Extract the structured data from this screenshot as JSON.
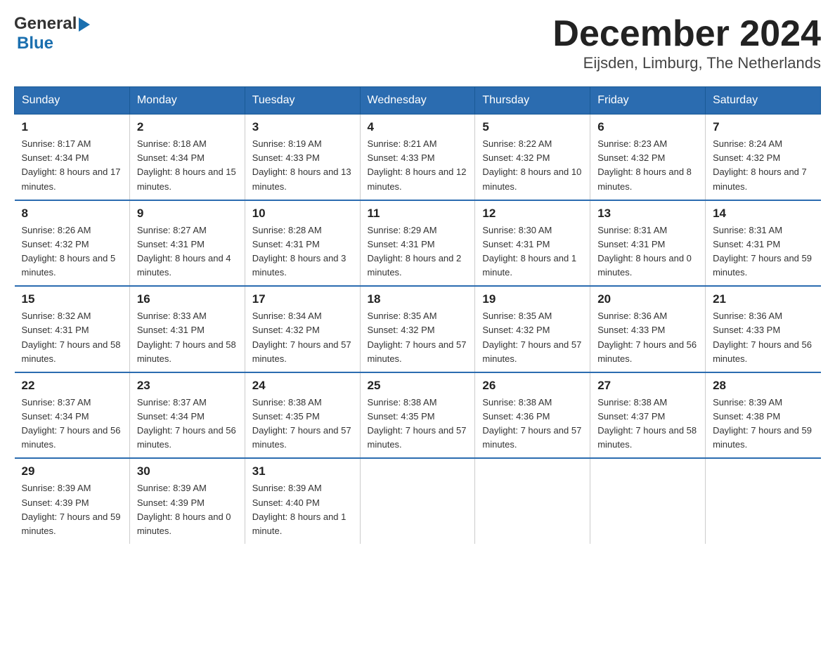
{
  "header": {
    "logo_general": "General",
    "logo_blue": "Blue",
    "month_title": "December 2024",
    "location": "Eijsden, Limburg, The Netherlands"
  },
  "days_of_week": [
    "Sunday",
    "Monday",
    "Tuesday",
    "Wednesday",
    "Thursday",
    "Friday",
    "Saturday"
  ],
  "weeks": [
    [
      {
        "day": "1",
        "sunrise": "8:17 AM",
        "sunset": "4:34 PM",
        "daylight": "8 hours and 17 minutes."
      },
      {
        "day": "2",
        "sunrise": "8:18 AM",
        "sunset": "4:34 PM",
        "daylight": "8 hours and 15 minutes."
      },
      {
        "day": "3",
        "sunrise": "8:19 AM",
        "sunset": "4:33 PM",
        "daylight": "8 hours and 13 minutes."
      },
      {
        "day": "4",
        "sunrise": "8:21 AM",
        "sunset": "4:33 PM",
        "daylight": "8 hours and 12 minutes."
      },
      {
        "day": "5",
        "sunrise": "8:22 AM",
        "sunset": "4:32 PM",
        "daylight": "8 hours and 10 minutes."
      },
      {
        "day": "6",
        "sunrise": "8:23 AM",
        "sunset": "4:32 PM",
        "daylight": "8 hours and 8 minutes."
      },
      {
        "day": "7",
        "sunrise": "8:24 AM",
        "sunset": "4:32 PM",
        "daylight": "8 hours and 7 minutes."
      }
    ],
    [
      {
        "day": "8",
        "sunrise": "8:26 AM",
        "sunset": "4:32 PM",
        "daylight": "8 hours and 5 minutes."
      },
      {
        "day": "9",
        "sunrise": "8:27 AM",
        "sunset": "4:31 PM",
        "daylight": "8 hours and 4 minutes."
      },
      {
        "day": "10",
        "sunrise": "8:28 AM",
        "sunset": "4:31 PM",
        "daylight": "8 hours and 3 minutes."
      },
      {
        "day": "11",
        "sunrise": "8:29 AM",
        "sunset": "4:31 PM",
        "daylight": "8 hours and 2 minutes."
      },
      {
        "day": "12",
        "sunrise": "8:30 AM",
        "sunset": "4:31 PM",
        "daylight": "8 hours and 1 minute."
      },
      {
        "day": "13",
        "sunrise": "8:31 AM",
        "sunset": "4:31 PM",
        "daylight": "8 hours and 0 minutes."
      },
      {
        "day": "14",
        "sunrise": "8:31 AM",
        "sunset": "4:31 PM",
        "daylight": "7 hours and 59 minutes."
      }
    ],
    [
      {
        "day": "15",
        "sunrise": "8:32 AM",
        "sunset": "4:31 PM",
        "daylight": "7 hours and 58 minutes."
      },
      {
        "day": "16",
        "sunrise": "8:33 AM",
        "sunset": "4:31 PM",
        "daylight": "7 hours and 58 minutes."
      },
      {
        "day": "17",
        "sunrise": "8:34 AM",
        "sunset": "4:32 PM",
        "daylight": "7 hours and 57 minutes."
      },
      {
        "day": "18",
        "sunrise": "8:35 AM",
        "sunset": "4:32 PM",
        "daylight": "7 hours and 57 minutes."
      },
      {
        "day": "19",
        "sunrise": "8:35 AM",
        "sunset": "4:32 PM",
        "daylight": "7 hours and 57 minutes."
      },
      {
        "day": "20",
        "sunrise": "8:36 AM",
        "sunset": "4:33 PM",
        "daylight": "7 hours and 56 minutes."
      },
      {
        "day": "21",
        "sunrise": "8:36 AM",
        "sunset": "4:33 PM",
        "daylight": "7 hours and 56 minutes."
      }
    ],
    [
      {
        "day": "22",
        "sunrise": "8:37 AM",
        "sunset": "4:34 PM",
        "daylight": "7 hours and 56 minutes."
      },
      {
        "day": "23",
        "sunrise": "8:37 AM",
        "sunset": "4:34 PM",
        "daylight": "7 hours and 56 minutes."
      },
      {
        "day": "24",
        "sunrise": "8:38 AM",
        "sunset": "4:35 PM",
        "daylight": "7 hours and 57 minutes."
      },
      {
        "day": "25",
        "sunrise": "8:38 AM",
        "sunset": "4:35 PM",
        "daylight": "7 hours and 57 minutes."
      },
      {
        "day": "26",
        "sunrise": "8:38 AM",
        "sunset": "4:36 PM",
        "daylight": "7 hours and 57 minutes."
      },
      {
        "day": "27",
        "sunrise": "8:38 AM",
        "sunset": "4:37 PM",
        "daylight": "7 hours and 58 minutes."
      },
      {
        "day": "28",
        "sunrise": "8:39 AM",
        "sunset": "4:38 PM",
        "daylight": "7 hours and 59 minutes."
      }
    ],
    [
      {
        "day": "29",
        "sunrise": "8:39 AM",
        "sunset": "4:39 PM",
        "daylight": "7 hours and 59 minutes."
      },
      {
        "day": "30",
        "sunrise": "8:39 AM",
        "sunset": "4:39 PM",
        "daylight": "8 hours and 0 minutes."
      },
      {
        "day": "31",
        "sunrise": "8:39 AM",
        "sunset": "4:40 PM",
        "daylight": "8 hours and 1 minute."
      },
      null,
      null,
      null,
      null
    ]
  ]
}
